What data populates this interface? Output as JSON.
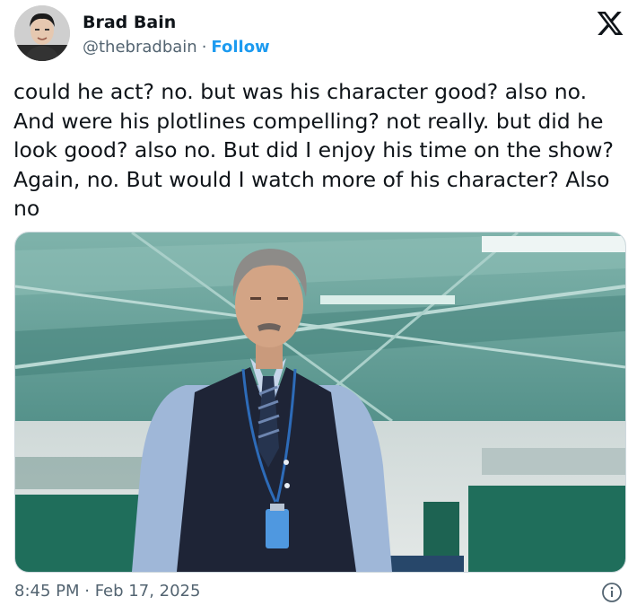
{
  "author": {
    "name": "Brad Bain",
    "handle": "@thebradbain",
    "separator": "·",
    "follow_label": "Follow",
    "avatar_icon": "avatar-photo"
  },
  "tweet": {
    "lines": [
      "could he act? no. but was his character good? also no.",
      "And were his plotlines compelling? not really. but did he",
      "look good? also no. But did I enjoy his time on the show?",
      "Again, no. But would I watch more of his character? Also",
      "no"
    ]
  },
  "media": {
    "description_icon": "man-in-office-photo",
    "colors": {
      "ceiling": "#5f9c94",
      "wall": "#d8dedd",
      "vest": "#1e2436",
      "shirt": "#9fb7d8",
      "partition": "#1f6e5b"
    }
  },
  "footer": {
    "timestamp": "8:45 PM · Feb 17, 2025"
  },
  "icons": {
    "brand": "x-logo-icon",
    "info": "info-icon"
  },
  "colors": {
    "text": "#0f1419",
    "muted": "#536471",
    "accent": "#1d9bf0"
  }
}
